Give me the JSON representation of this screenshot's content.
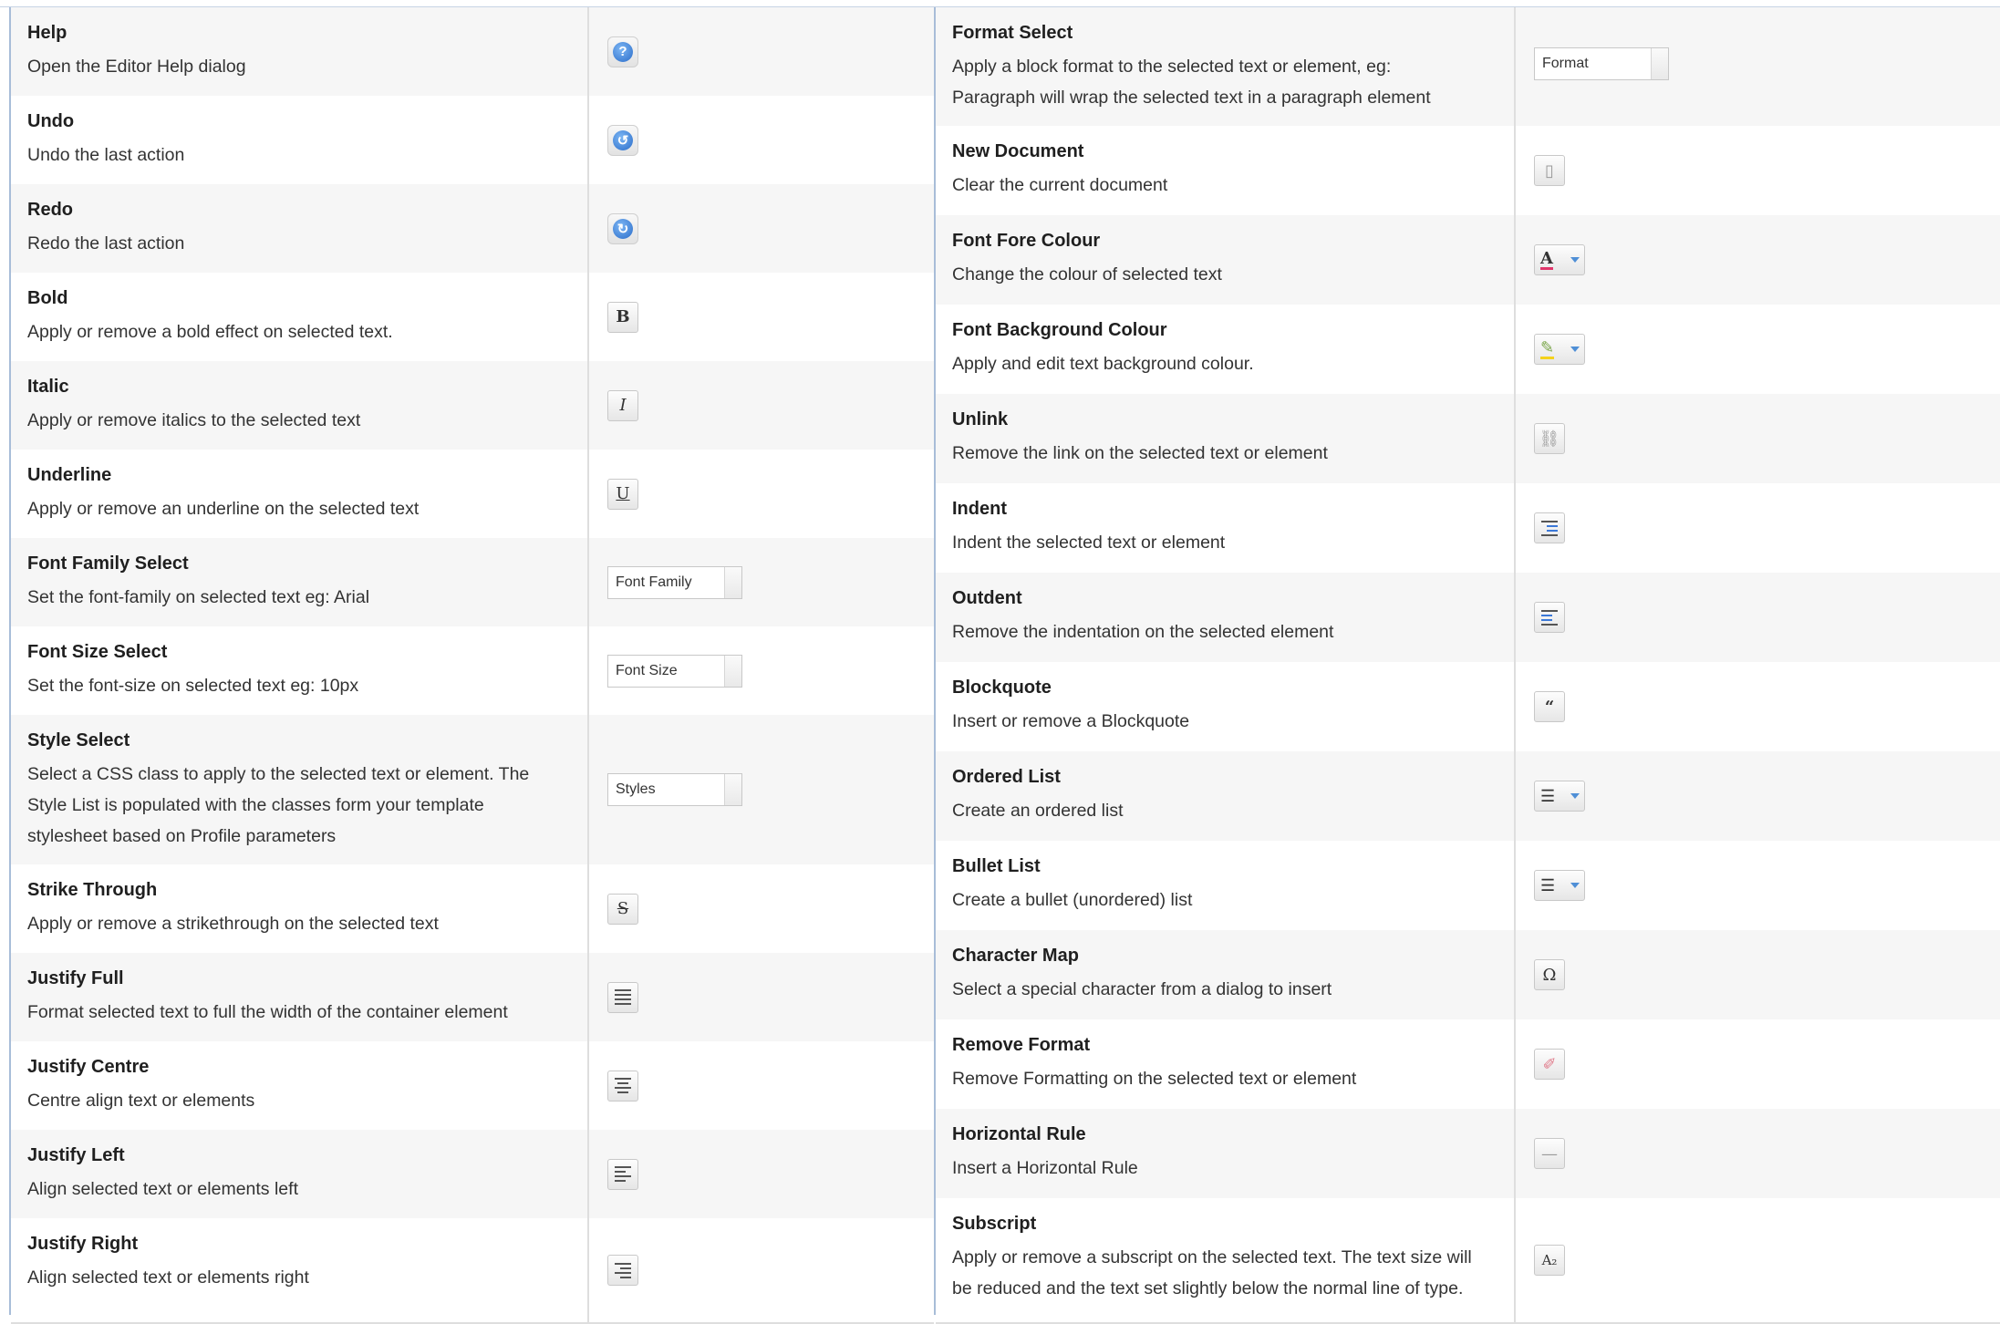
{
  "left_rows": [
    {
      "title": "Help",
      "desc": [
        "Open the Editor Help dialog"
      ],
      "icon": "help-icon",
      "glyph": "?"
    },
    {
      "title": "Undo",
      "desc": [
        "Undo the last action"
      ],
      "icon": "undo-icon",
      "glyph": "↺"
    },
    {
      "title": "Redo",
      "desc": [
        "Redo the last action"
      ],
      "icon": "redo-icon",
      "glyph": "↻"
    },
    {
      "title": "Bold",
      "desc": [
        "Apply or remove a bold effect on selected text."
      ],
      "icon": "bold-icon",
      "glyph": "B"
    },
    {
      "title": "Italic",
      "desc": [
        "Apply or remove italics to the selected text"
      ],
      "icon": "italic-icon",
      "glyph": "I"
    },
    {
      "title": "Underline",
      "desc": [
        "Apply or remove an underline on the selected text"
      ],
      "icon": "underline-icon",
      "glyph": "U"
    },
    {
      "title": "Font Family Select",
      "desc": [
        "Set the font-family on selected text eg: Arial"
      ],
      "icon": "font-family-select",
      "select": "Font Family"
    },
    {
      "title": "Font Size Select",
      "desc": [
        "Set the font-size on selected text eg: 10px"
      ],
      "icon": "font-size-select",
      "select": "Font Size"
    },
    {
      "title": "Style Select",
      "desc": [
        "Select a CSS class to apply to the selected text or element. The",
        "Style List is populated with the classes form your template",
        "stylesheet based on Profile parameters"
      ],
      "icon": "style-select",
      "select": "Styles"
    },
    {
      "title": "Strike Through",
      "desc": [
        "Apply or remove a strikethrough on the selected text"
      ],
      "icon": "strikethrough-icon",
      "glyph": "S"
    },
    {
      "title": "Justify Full",
      "desc": [
        "Format selected text to full the width of the container element"
      ],
      "icon": "justify-full-icon",
      "glyph": "≡"
    },
    {
      "title": "Justify Centre",
      "desc": [
        "Centre align text or elements"
      ],
      "icon": "justify-centre-icon",
      "glyph": "≡"
    },
    {
      "title": "Justify Left",
      "desc": [
        "Align selected text or elements left"
      ],
      "icon": "justify-left-icon",
      "glyph": "≡"
    },
    {
      "title": "Justify Right",
      "desc": [
        "Align selected text or elements right"
      ],
      "icon": "justify-right-icon",
      "glyph": "≡"
    }
  ],
  "right_rows": [
    {
      "title": "Format Select",
      "desc": [
        "Apply a block format to the selected text or element, eg:",
        "Paragraph will wrap the selected text in a paragraph element"
      ],
      "icon": "format-select",
      "select": "Format"
    },
    {
      "title": "New Document",
      "desc": [
        "Clear the current document"
      ],
      "icon": "new-document-icon",
      "glyph": "▯"
    },
    {
      "title": "Font Fore Colour",
      "desc": [
        "Change the colour of selected text"
      ],
      "icon": "font-fore-colour-icon",
      "glyph": "A"
    },
    {
      "title": "Font Background Colour",
      "desc": [
        "Apply and edit text background colour."
      ],
      "icon": "font-background-colour-icon",
      "glyph": "✎"
    },
    {
      "title": "Unlink",
      "desc": [
        "Remove the link on the selected text or element"
      ],
      "icon": "unlink-icon",
      "glyph": "⛓"
    },
    {
      "title": "Indent",
      "desc": [
        "Indent the selected text or element"
      ],
      "icon": "indent-icon",
      "glyph": "≣"
    },
    {
      "title": "Outdent",
      "desc": [
        "Remove the indentation on the selected element"
      ],
      "icon": "outdent-icon",
      "glyph": "≣"
    },
    {
      "title": "Blockquote",
      "desc": [
        "Insert or remove a Blockquote"
      ],
      "icon": "blockquote-icon",
      "glyph": "“"
    },
    {
      "title": "Ordered List",
      "desc": [
        "Create an ordered list"
      ],
      "icon": "ordered-list-icon",
      "glyph": "☰"
    },
    {
      "title": "Bullet List",
      "desc": [
        "Create a bullet (unordered) list"
      ],
      "icon": "bullet-list-icon",
      "glyph": "☰"
    },
    {
      "title": "Character Map",
      "desc": [
        "Select a special character from a dialog to insert"
      ],
      "icon": "character-map-icon",
      "glyph": "Ω"
    },
    {
      "title": "Remove Format",
      "desc": [
        "Remove Formatting on the selected text or element"
      ],
      "icon": "remove-format-icon",
      "glyph": "✐"
    },
    {
      "title": "Horizontal Rule",
      "desc": [
        "Insert a Horizontal Rule"
      ],
      "icon": "horizontal-rule-icon",
      "glyph": "—"
    },
    {
      "title": "Subscript",
      "desc": [
        "Apply or remove a subscript on the selected text. The text size will",
        "be reduced and the text set slightly below the normal line of type."
      ],
      "icon": "subscript-icon",
      "glyph": "A₂"
    }
  ],
  "colors": {
    "accent": "#2a6cc9",
    "row_bg": "#f6f6f6",
    "border": "#dedede",
    "panel_border": "#a8bdd8"
  }
}
